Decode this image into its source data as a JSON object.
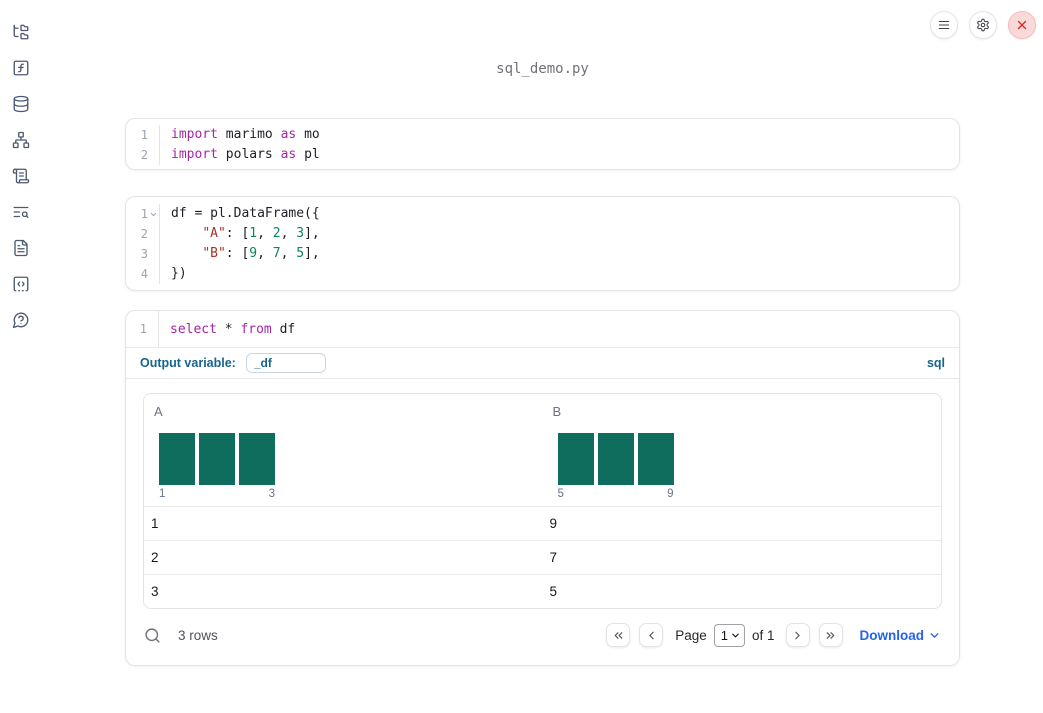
{
  "header": {
    "filename": "sql_demo.py"
  },
  "colors": {
    "keyword": "#a626a4",
    "string": "#a93229",
    "number": "#0b8658",
    "plain": "#1c1f26",
    "bar_teal": "#0e6d5c",
    "label_blue": "#17648f",
    "link_blue": "#2563eb"
  },
  "sidebar": {
    "items": [
      {
        "name": "files",
        "icon": "folder-tree-icon"
      },
      {
        "name": "variables",
        "icon": "function-square-icon"
      },
      {
        "name": "datasources",
        "icon": "database-icon"
      },
      {
        "name": "dependencies",
        "icon": "network-icon"
      },
      {
        "name": "outline",
        "icon": "scroll-text-icon"
      },
      {
        "name": "logs",
        "icon": "text-search-icon"
      },
      {
        "name": "documentation",
        "icon": "file-text-icon"
      },
      {
        "name": "snippets",
        "icon": "code-square-icon"
      },
      {
        "name": "help",
        "icon": "help-circle-icon"
      }
    ]
  },
  "topbar": {
    "buttons": [
      {
        "name": "menu",
        "icon": "menu-icon",
        "danger": false
      },
      {
        "name": "settings",
        "icon": "gear-icon",
        "danger": false
      },
      {
        "name": "shutdown",
        "icon": "close-icon",
        "danger": true
      }
    ]
  },
  "cells": [
    {
      "name": "imports-cell",
      "lines": [
        {
          "n": "1",
          "tokens": [
            [
              "kw",
              "import"
            ],
            [
              "pl",
              " marimo "
            ],
            [
              "kw",
              "as"
            ],
            [
              "pl",
              " mo"
            ]
          ]
        },
        {
          "n": "2",
          "tokens": [
            [
              "kw",
              "import"
            ],
            [
              "pl",
              " polars "
            ],
            [
              "kw",
              "as"
            ],
            [
              "pl",
              " pl"
            ]
          ]
        }
      ]
    },
    {
      "name": "dataframe-cell",
      "lines": [
        {
          "n": "1",
          "fold": true,
          "tokens": [
            [
              "pl",
              "df = pl.DataFrame({"
            ]
          ]
        },
        {
          "n": "2",
          "tokens": [
            [
              "pl",
              "    "
            ],
            [
              "str",
              "\"A\""
            ],
            [
              "pl",
              ": ["
            ],
            [
              "num",
              "1"
            ],
            [
              "pl",
              ", "
            ],
            [
              "num",
              "2"
            ],
            [
              "pl",
              ", "
            ],
            [
              "num",
              "3"
            ],
            [
              "pl",
              "],"
            ]
          ]
        },
        {
          "n": "3",
          "tokens": [
            [
              "pl",
              "    "
            ],
            [
              "str",
              "\"B\""
            ],
            [
              "pl",
              ": ["
            ],
            [
              "num",
              "9"
            ],
            [
              "pl",
              ", "
            ],
            [
              "num",
              "7"
            ],
            [
              "pl",
              ", "
            ],
            [
              "num",
              "5"
            ],
            [
              "pl",
              "],"
            ]
          ]
        },
        {
          "n": "4",
          "tokens": [
            [
              "pl",
              "})"
            ]
          ]
        }
      ]
    },
    {
      "name": "sql-cell",
      "lines": [
        {
          "n": "1",
          "tokens": [
            [
              "kw",
              "select"
            ],
            [
              "pl",
              " * "
            ],
            [
              "kw",
              "from"
            ],
            [
              "pl",
              " df"
            ]
          ]
        }
      ]
    }
  ],
  "sql_cell": {
    "output_variable_label": "Output variable:",
    "output_variable_value": "_df",
    "language_badge": "sql"
  },
  "table": {
    "columns": [
      {
        "name": "A",
        "hist": {
          "bars": [
            1,
            1,
            1
          ],
          "min_label": "1",
          "max_label": "3"
        }
      },
      {
        "name": "B",
        "hist": {
          "bars": [
            1,
            1,
            1
          ],
          "min_label": "5",
          "max_label": "9"
        }
      }
    ],
    "rows": [
      [
        "1",
        "9"
      ],
      [
        "2",
        "7"
      ],
      [
        "3",
        "5"
      ]
    ],
    "footer": {
      "row_count": "3 rows",
      "page_label": "Page",
      "page_value": "1",
      "of_label": "of 1",
      "download_label": "Download"
    }
  }
}
